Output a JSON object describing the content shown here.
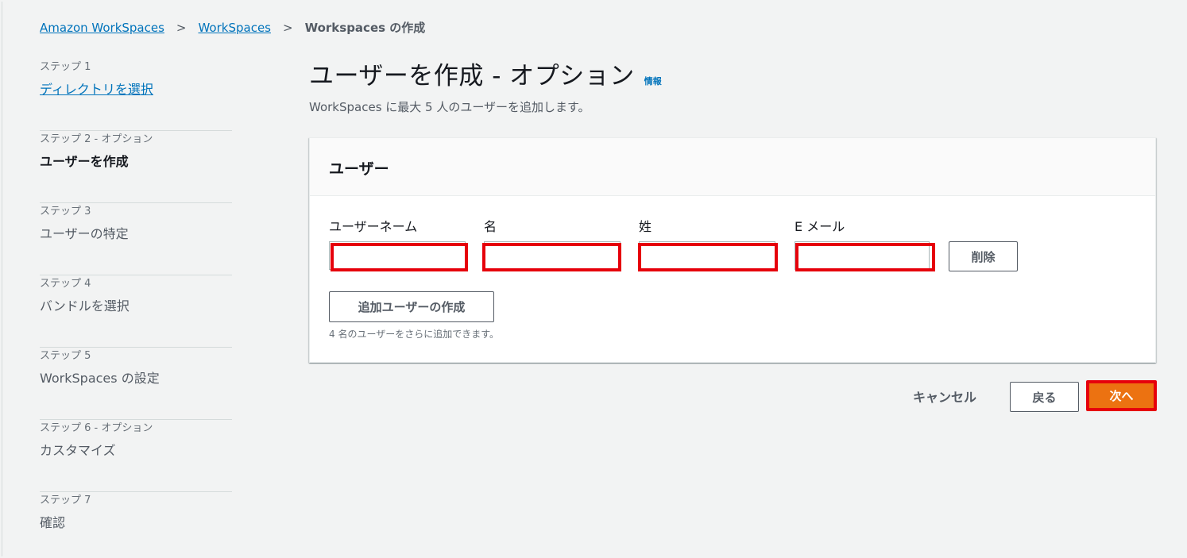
{
  "breadcrumb": {
    "items": [
      "Amazon WorkSpaces",
      "WorkSpaces"
    ],
    "current": "Workspaces の作成",
    "separator": ">"
  },
  "steps": [
    {
      "num": "ステップ 1",
      "title": "ディレクトリを選択",
      "state": "link"
    },
    {
      "num": "ステップ 2 - オプション",
      "title": "ユーザーを作成",
      "state": "active"
    },
    {
      "num": "ステップ 3",
      "title": "ユーザーの特定",
      "state": "default"
    },
    {
      "num": "ステップ 4",
      "title": "バンドルを選択",
      "state": "default"
    },
    {
      "num": "ステップ 5",
      "title": "WorkSpaces の設定",
      "state": "default"
    },
    {
      "num": "ステップ 6 - オプション",
      "title": "カスタマイズ",
      "state": "default"
    },
    {
      "num": "ステップ 7",
      "title": "確認",
      "state": "default"
    }
  ],
  "main": {
    "title": "ユーザーを作成 - オプション",
    "info_label": "情報",
    "subtitle": "WorkSpaces に最大 5 人のユーザーを追加します。"
  },
  "panel": {
    "title": "ユーザー",
    "fields": {
      "username_label": "ユーザーネーム",
      "firstname_label": "名",
      "lastname_label": "姓",
      "email_label": "E メール",
      "username_value": "",
      "firstname_value": "",
      "lastname_value": "",
      "email_value": ""
    },
    "remove_label": "削除",
    "add_user_label": "追加ユーザーの作成",
    "add_hint": "4 名のユーザーをさらに追加できます。"
  },
  "actions": {
    "cancel_label": "キャンセル",
    "back_label": "戻る",
    "next_label": "次へ"
  },
  "colors": {
    "link": "#0073bb",
    "primary_button": "#ec7211",
    "highlight": "#e6000b",
    "background": "#f2f3f3"
  }
}
